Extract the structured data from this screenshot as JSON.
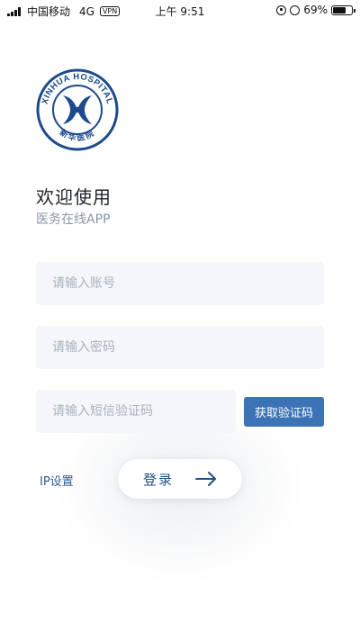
{
  "status_bar": {
    "carrier": "中国移动",
    "network": "4G",
    "vpn": "VPN",
    "time": "上午 9:51",
    "battery_percent": "69%",
    "battery_level": 0.69,
    "icons": [
      "signal-icon",
      "lock-rotation-icon",
      "alarm-icon",
      "battery-icon"
    ]
  },
  "logo": {
    "ring_text": "XINHUA HOSPITAL",
    "center_text": "新华医院",
    "color": "#1c4a8c"
  },
  "header": {
    "title": "欢迎使用",
    "subtitle": "医务在线APP"
  },
  "form": {
    "account_placeholder": "请输入账号",
    "password_placeholder": "请输入密码",
    "sms_placeholder": "请输入短信验证码",
    "get_code_label": "获取验证码"
  },
  "footer": {
    "ip_settings_label": "IP设置",
    "login_label": "登录"
  },
  "colors": {
    "accent": "#3b73b6",
    "link": "#2f5f94",
    "input_bg": "#f4f6f9",
    "placeholder": "#a9b2bc"
  }
}
